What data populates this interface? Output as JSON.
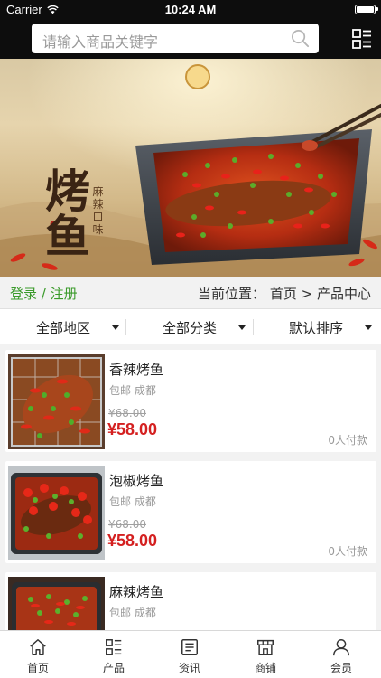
{
  "status_bar": {
    "carrier": "Carrier",
    "time": "10:24 AM"
  },
  "search": {
    "placeholder": "请输入商品关键字"
  },
  "banner": {
    "title": "烤鱼",
    "tagline": "麻辣口味"
  },
  "location_bar": {
    "login": "登录",
    "separator": "/",
    "register": "注册",
    "prefix": "当前位置：",
    "home": "首页",
    "arrow": ">",
    "current": "产品中心"
  },
  "filters": [
    {
      "label": "全部地区"
    },
    {
      "label": "全部分类"
    },
    {
      "label": "默认排序"
    }
  ],
  "products": [
    {
      "name": "香辣烤鱼",
      "tags": "包邮 成都",
      "old_price": "¥68.00",
      "price": "¥58.00",
      "sold": "0人付款"
    },
    {
      "name": "泡椒烤鱼",
      "tags": "包邮 成都",
      "old_price": "¥68.00",
      "price": "¥58.00",
      "sold": "0人付款"
    },
    {
      "name": "麻辣烤鱼",
      "tags": "包邮 成都"
    }
  ],
  "bottom_nav": [
    {
      "label": "首页",
      "icon": "home-icon"
    },
    {
      "label": "产品",
      "icon": "grid-list-icon"
    },
    {
      "label": "资讯",
      "icon": "news-icon"
    },
    {
      "label": "商铺",
      "icon": "store-icon"
    },
    {
      "label": "会员",
      "icon": "user-icon"
    }
  ],
  "colors": {
    "accent_green": "#3a9a2a",
    "price_red": "#d42020",
    "header_bg": "#0d0d0d"
  }
}
